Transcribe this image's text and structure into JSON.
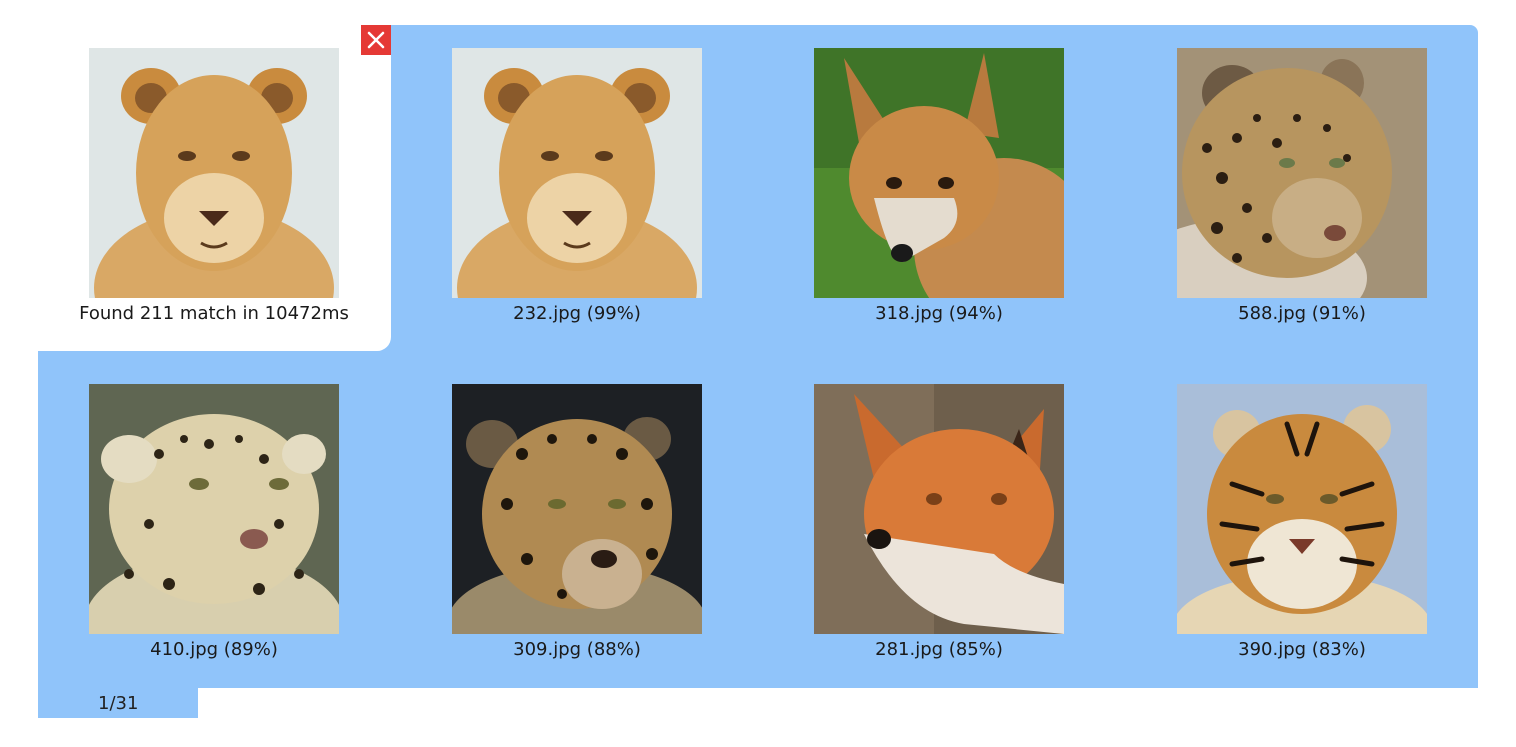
{
  "query": {
    "image_subject": "lioness",
    "status_text": "Found 211 match in 10472ms"
  },
  "close_button": {
    "icon": "close-icon",
    "color": "#e53935"
  },
  "panel_color": "#90c4fa",
  "results": [
    {
      "subject": "lioness",
      "caption": "232.jpg (99%)"
    },
    {
      "subject": "red fox on grass",
      "caption": "318.jpg (94%)"
    },
    {
      "subject": "leopard",
      "caption": "588.jpg (91%)"
    },
    {
      "subject": "leopard",
      "caption": "410.jpg (89%)"
    },
    {
      "subject": "jaguar",
      "caption": "309.jpg (88%)"
    },
    {
      "subject": "red fox",
      "caption": "281.jpg (85%)"
    },
    {
      "subject": "tiger",
      "caption": "390.jpg (83%)"
    }
  ],
  "pager": {
    "text": "1/31"
  }
}
